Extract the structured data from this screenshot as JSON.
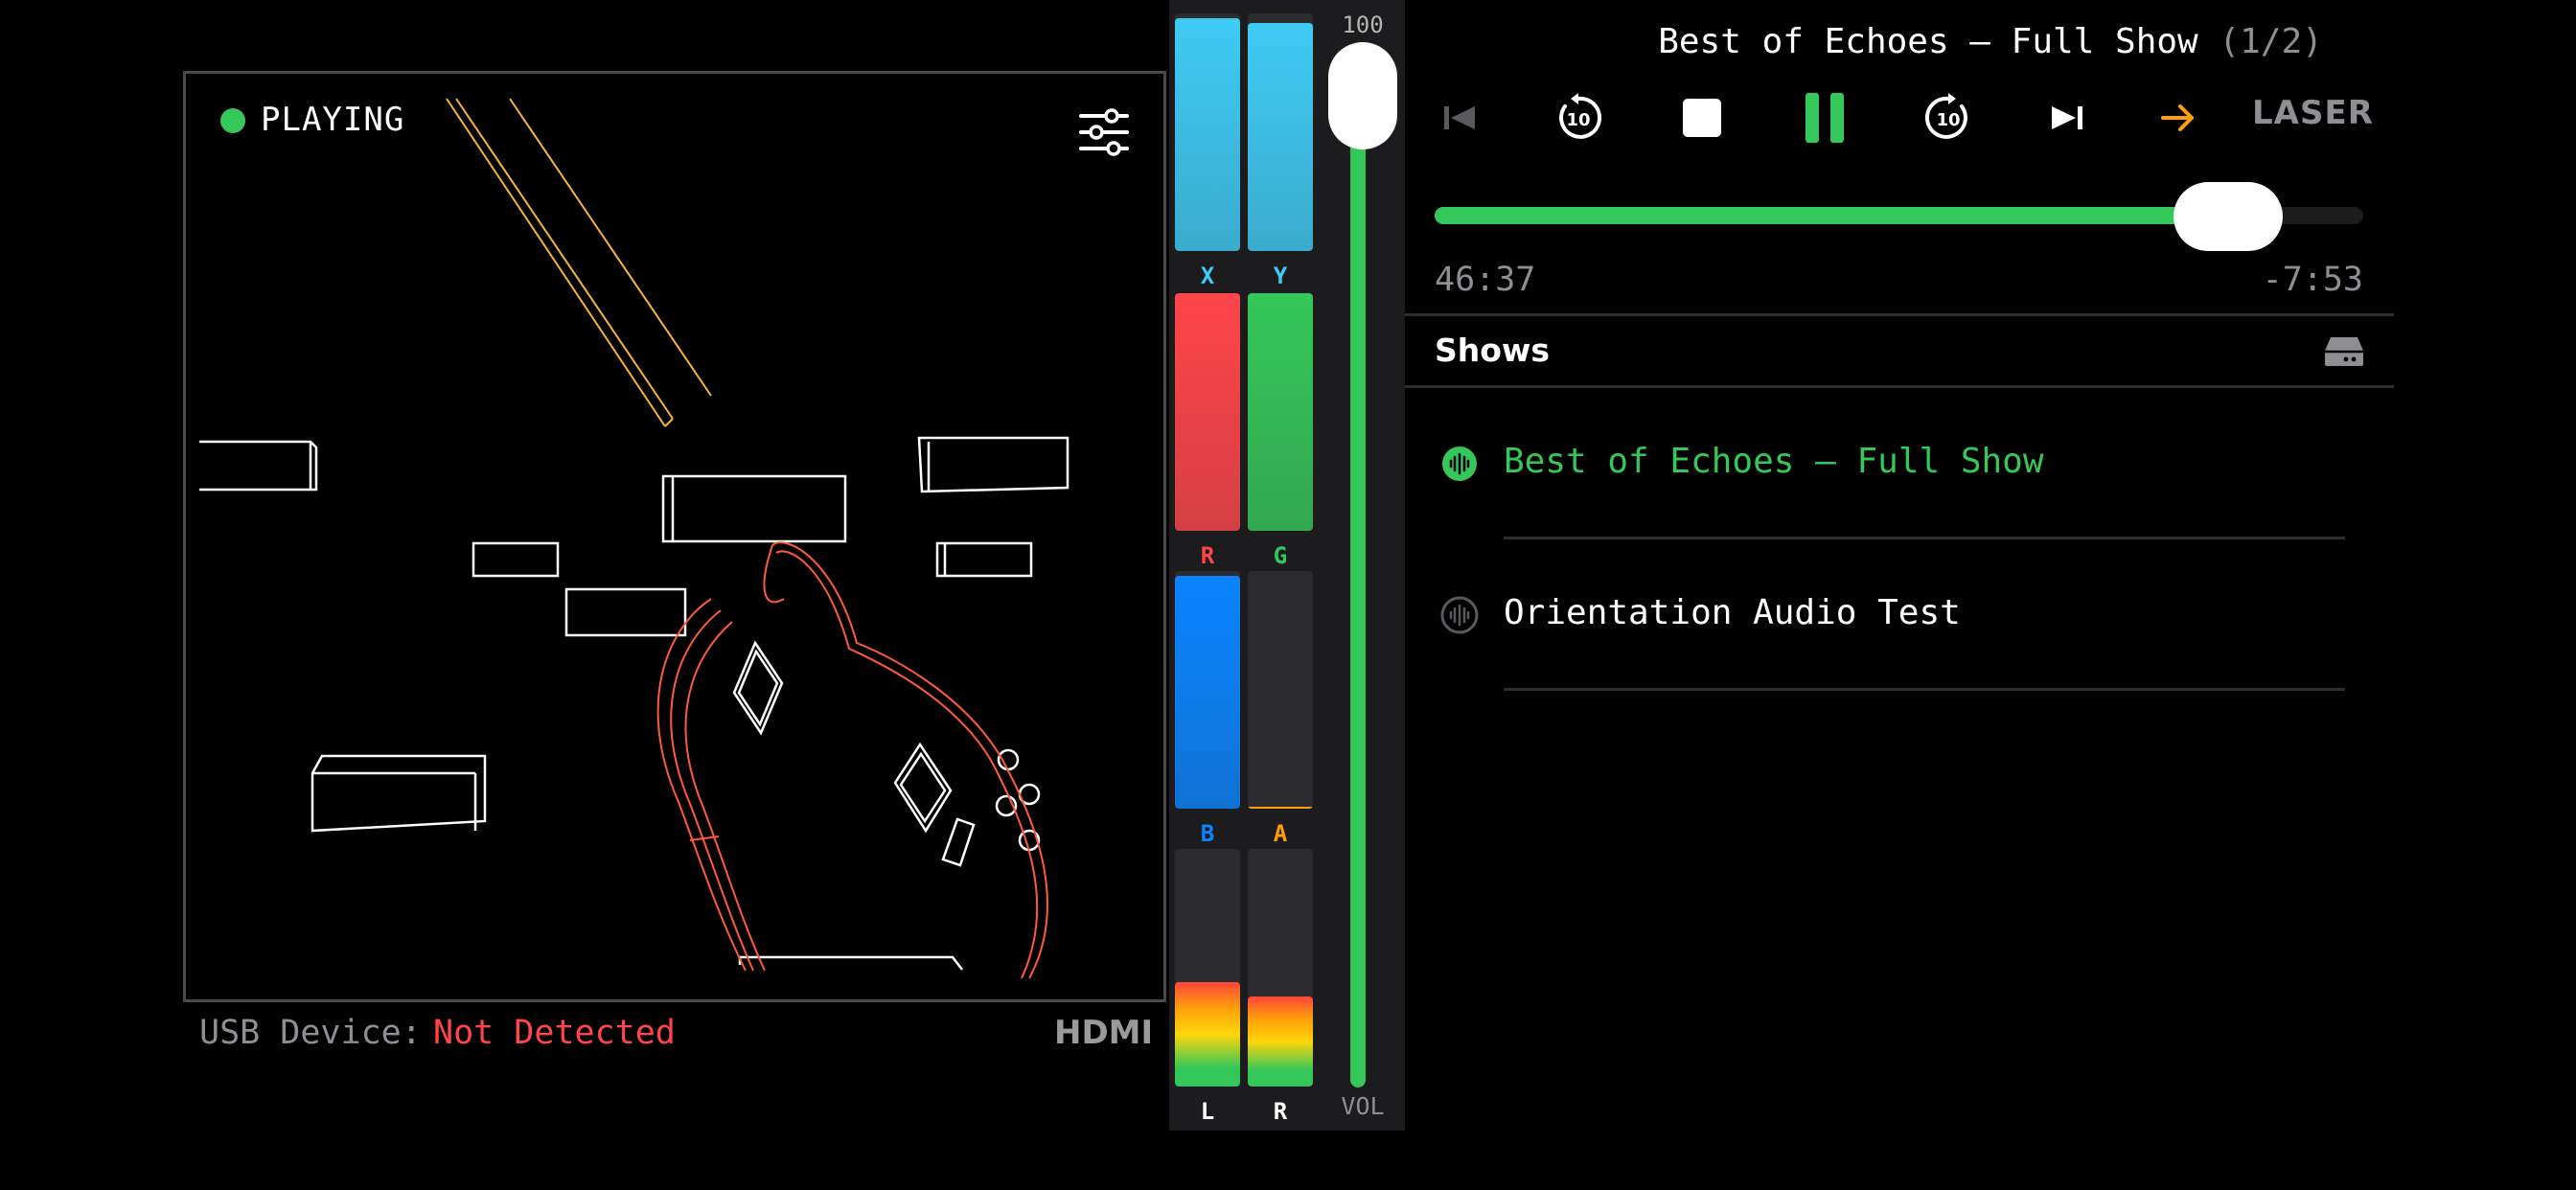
{
  "preview": {
    "status": "PLAYING",
    "usb_label": "USB Device:",
    "usb_status": "Not Detected",
    "output": "HDMI"
  },
  "meters": [
    {
      "label": "X",
      "level": 0.98,
      "color": "#3ecbf5",
      "label_color": "#3ecbf5"
    },
    {
      "label": "Y",
      "level": 0.96,
      "color": "#3ecbf5",
      "label_color": "#3ecbf5"
    },
    {
      "label": "R",
      "level": 1.0,
      "color": "#ff4549",
      "label_color": "#ff4549"
    },
    {
      "label": "G",
      "level": 1.0,
      "color": "#34c759",
      "label_color": "#34c759"
    },
    {
      "label": "B",
      "level": 0.98,
      "color": "#0a84ff",
      "label_color": "#0a84ff"
    },
    {
      "label": "A",
      "level": 0.0,
      "color": "#ff9f0a",
      "label_color": "#ff9f0a"
    },
    {
      "label": "L",
      "level": 0.44,
      "color": "audio",
      "label_color": "#ffffff"
    },
    {
      "label": "R",
      "level": 0.38,
      "color": "audio",
      "label_color": "#ffffff"
    }
  ],
  "volume": {
    "value": "100",
    "label": "VOL",
    "level": 1.0
  },
  "player": {
    "title": "Best of Echoes – Full Show",
    "position": "(1/2)",
    "elapsed": "46:37",
    "remaining": "-7:53",
    "progress": 0.855,
    "mode_label": "LASER",
    "colors": {
      "accent": "#34c759",
      "next_arrow": "#ff9f0a",
      "disabled": "#5a5a5e"
    }
  },
  "shows": {
    "header": "Shows",
    "items": [
      {
        "name": "Best of Echoes – Full Show",
        "active": true
      },
      {
        "name": "Orientation Audio Test",
        "active": false
      }
    ]
  }
}
